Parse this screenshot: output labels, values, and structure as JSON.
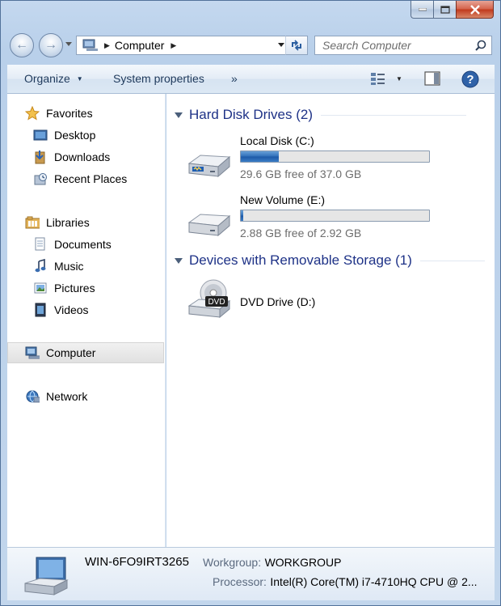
{
  "window": {
    "caption_buttons": [
      "minimize",
      "maximize",
      "close"
    ]
  },
  "address_bar": {
    "crumbs": [
      "Computer"
    ],
    "search_placeholder": "Search Computer"
  },
  "toolbar": {
    "organize_label": "Organize",
    "system_properties_label": "System properties",
    "more_label": "»"
  },
  "nav": {
    "favorites": "Favorites",
    "desktop": "Desktop",
    "downloads": "Downloads",
    "recent_places": "Recent Places",
    "libraries": "Libraries",
    "documents": "Documents",
    "music": "Music",
    "pictures": "Pictures",
    "videos": "Videos",
    "computer": "Computer",
    "network": "Network"
  },
  "groups": {
    "hard_disks": "Hard Disk Drives (2)",
    "removable": "Devices with Removable Storage (1)"
  },
  "drives": [
    {
      "name": "Local Disk (C:)",
      "free_text": "29.6 GB free of 37.0 GB",
      "used_fraction": 0.2
    },
    {
      "name": "New Volume (E:)",
      "free_text": "2.88 GB free of 2.92 GB",
      "used_fraction": 0.014
    }
  ],
  "dvd": {
    "name": "DVD Drive (D:)",
    "icon_text": "DVD"
  },
  "details": {
    "computer_name": "WIN-6FO9IRT3265",
    "workgroup_label": "Workgroup:",
    "workgroup_value": "WORKGROUP",
    "processor_label": "Processor:",
    "processor_value": "Intel(R) Core(TM) i7-4710HQ CPU @ 2..."
  }
}
